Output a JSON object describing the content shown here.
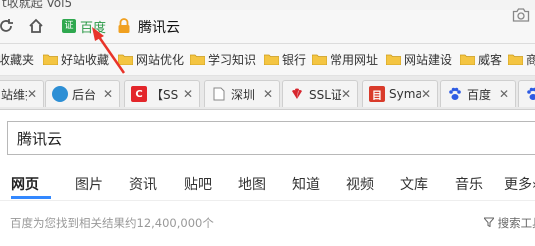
{
  "window": {
    "title_fragment": "t收就起 Vol5"
  },
  "address_bar": {
    "cert_badge": "证",
    "cert_name": "百度",
    "url_text": "腾讯云",
    "reload_icon": "reload-icon",
    "home_icon": "home-icon",
    "lock_color": "#f0a020"
  },
  "bookmarks": [
    {
      "label": "收藏夹"
    },
    {
      "label": "好站收藏"
    },
    {
      "label": "网站优化"
    },
    {
      "label": "学习知识"
    },
    {
      "label": "银行"
    },
    {
      "label": "常用网址"
    },
    {
      "label": "网站建设"
    },
    {
      "label": "威客"
    },
    {
      "label": "商"
    }
  ],
  "tabs": [
    {
      "label": "站维护",
      "icon": "page-icon"
    },
    {
      "label": "后台",
      "icon": "blue-circle-icon"
    },
    {
      "label": "【SS",
      "icon": "red-c-icon"
    },
    {
      "label": "深圳",
      "icon": "page-icon"
    },
    {
      "label": "SSL证",
      "icon": "huawei-icon"
    },
    {
      "label": "Syma",
      "icon": "red-box-icon"
    },
    {
      "label": "百度",
      "icon": "baidu-paw-icon"
    },
    {
      "label": "搜",
      "icon": "baidu-paw-icon"
    }
  ],
  "search": {
    "value": "腾讯云"
  },
  "nav_tabs": [
    {
      "label": "网页",
      "active": true
    },
    {
      "label": "图片"
    },
    {
      "label": "资讯"
    },
    {
      "label": "贴吧"
    },
    {
      "label": "地图"
    },
    {
      "label": "知道"
    },
    {
      "label": "视频"
    },
    {
      "label": "文库"
    },
    {
      "label": "音乐"
    },
    {
      "label": "更多»"
    }
  ],
  "results": {
    "count_text": "百度为您找到相关结果约12,400,000个",
    "filter_label": "搜索工具"
  },
  "colors": {
    "accent_blue": "#3388ff",
    "annotation_red": "#e8342a",
    "cert_green": "#2fa84f"
  }
}
